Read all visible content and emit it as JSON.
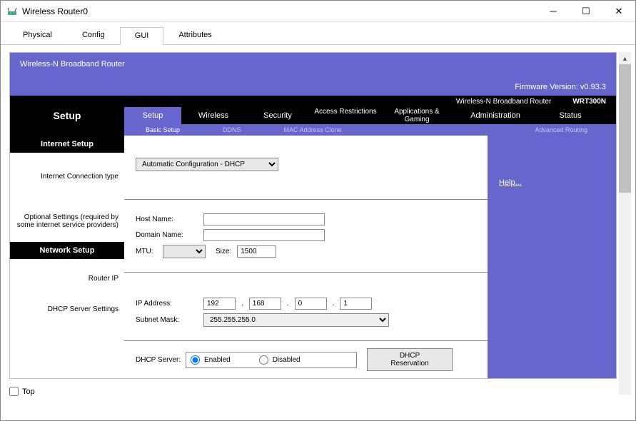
{
  "window": {
    "title": "Wireless Router0",
    "footer_checkbox": "Top"
  },
  "tabs": {
    "t0": "Physical",
    "t1": "Config",
    "t2": "GUI",
    "t3": "Attributes"
  },
  "banner": {
    "title": "Wireless-N Broadband Router",
    "firmware": "Firmware Version: v0.93.3",
    "brand": "Wireless-N Broadband Router",
    "model": "WRT300N"
  },
  "nav": {
    "label": "Setup",
    "t0": "Setup",
    "t1": "Wireless",
    "t2": "Security",
    "t3": "Access Restrictions",
    "t4": "Applications & Gaming",
    "t5": "Administration",
    "t6": "Status"
  },
  "subnav": {
    "s0": "Basic Setup",
    "s1": "DDNS",
    "s2": "MAC Address Clone",
    "s3": "Advanced Routing"
  },
  "sections": {
    "internet_setup": "Internet Setup",
    "internet_conn": "Internet Connection type",
    "optional": "Optional Settings (required by some internet service providers)",
    "network_setup": "Network Setup",
    "router_ip": "Router IP",
    "dhcp_server": "DHCP Server Settings"
  },
  "fields": {
    "conn_select": "Automatic Configuration - DHCP",
    "host_name_lbl": "Host Name:",
    "host_name_val": "",
    "domain_name_lbl": "Domain Name:",
    "domain_name_val": "",
    "mtu_lbl": "MTU:",
    "mtu_select": "",
    "size_lbl": "Size:",
    "size_val": "1500",
    "ip_lbl": "IP Address:",
    "ip_o1": "192",
    "ip_o2": "168",
    "ip_o3": "0",
    "ip_o4": "1",
    "mask_lbl": "Subnet Mask:",
    "mask_val": "255.255.255.0",
    "dhcp_srv_lbl": "DHCP Server:",
    "enabled": "Enabled",
    "disabled": "Disabled",
    "dhcp_reserve": "DHCP Reservation"
  },
  "help": "Help..."
}
